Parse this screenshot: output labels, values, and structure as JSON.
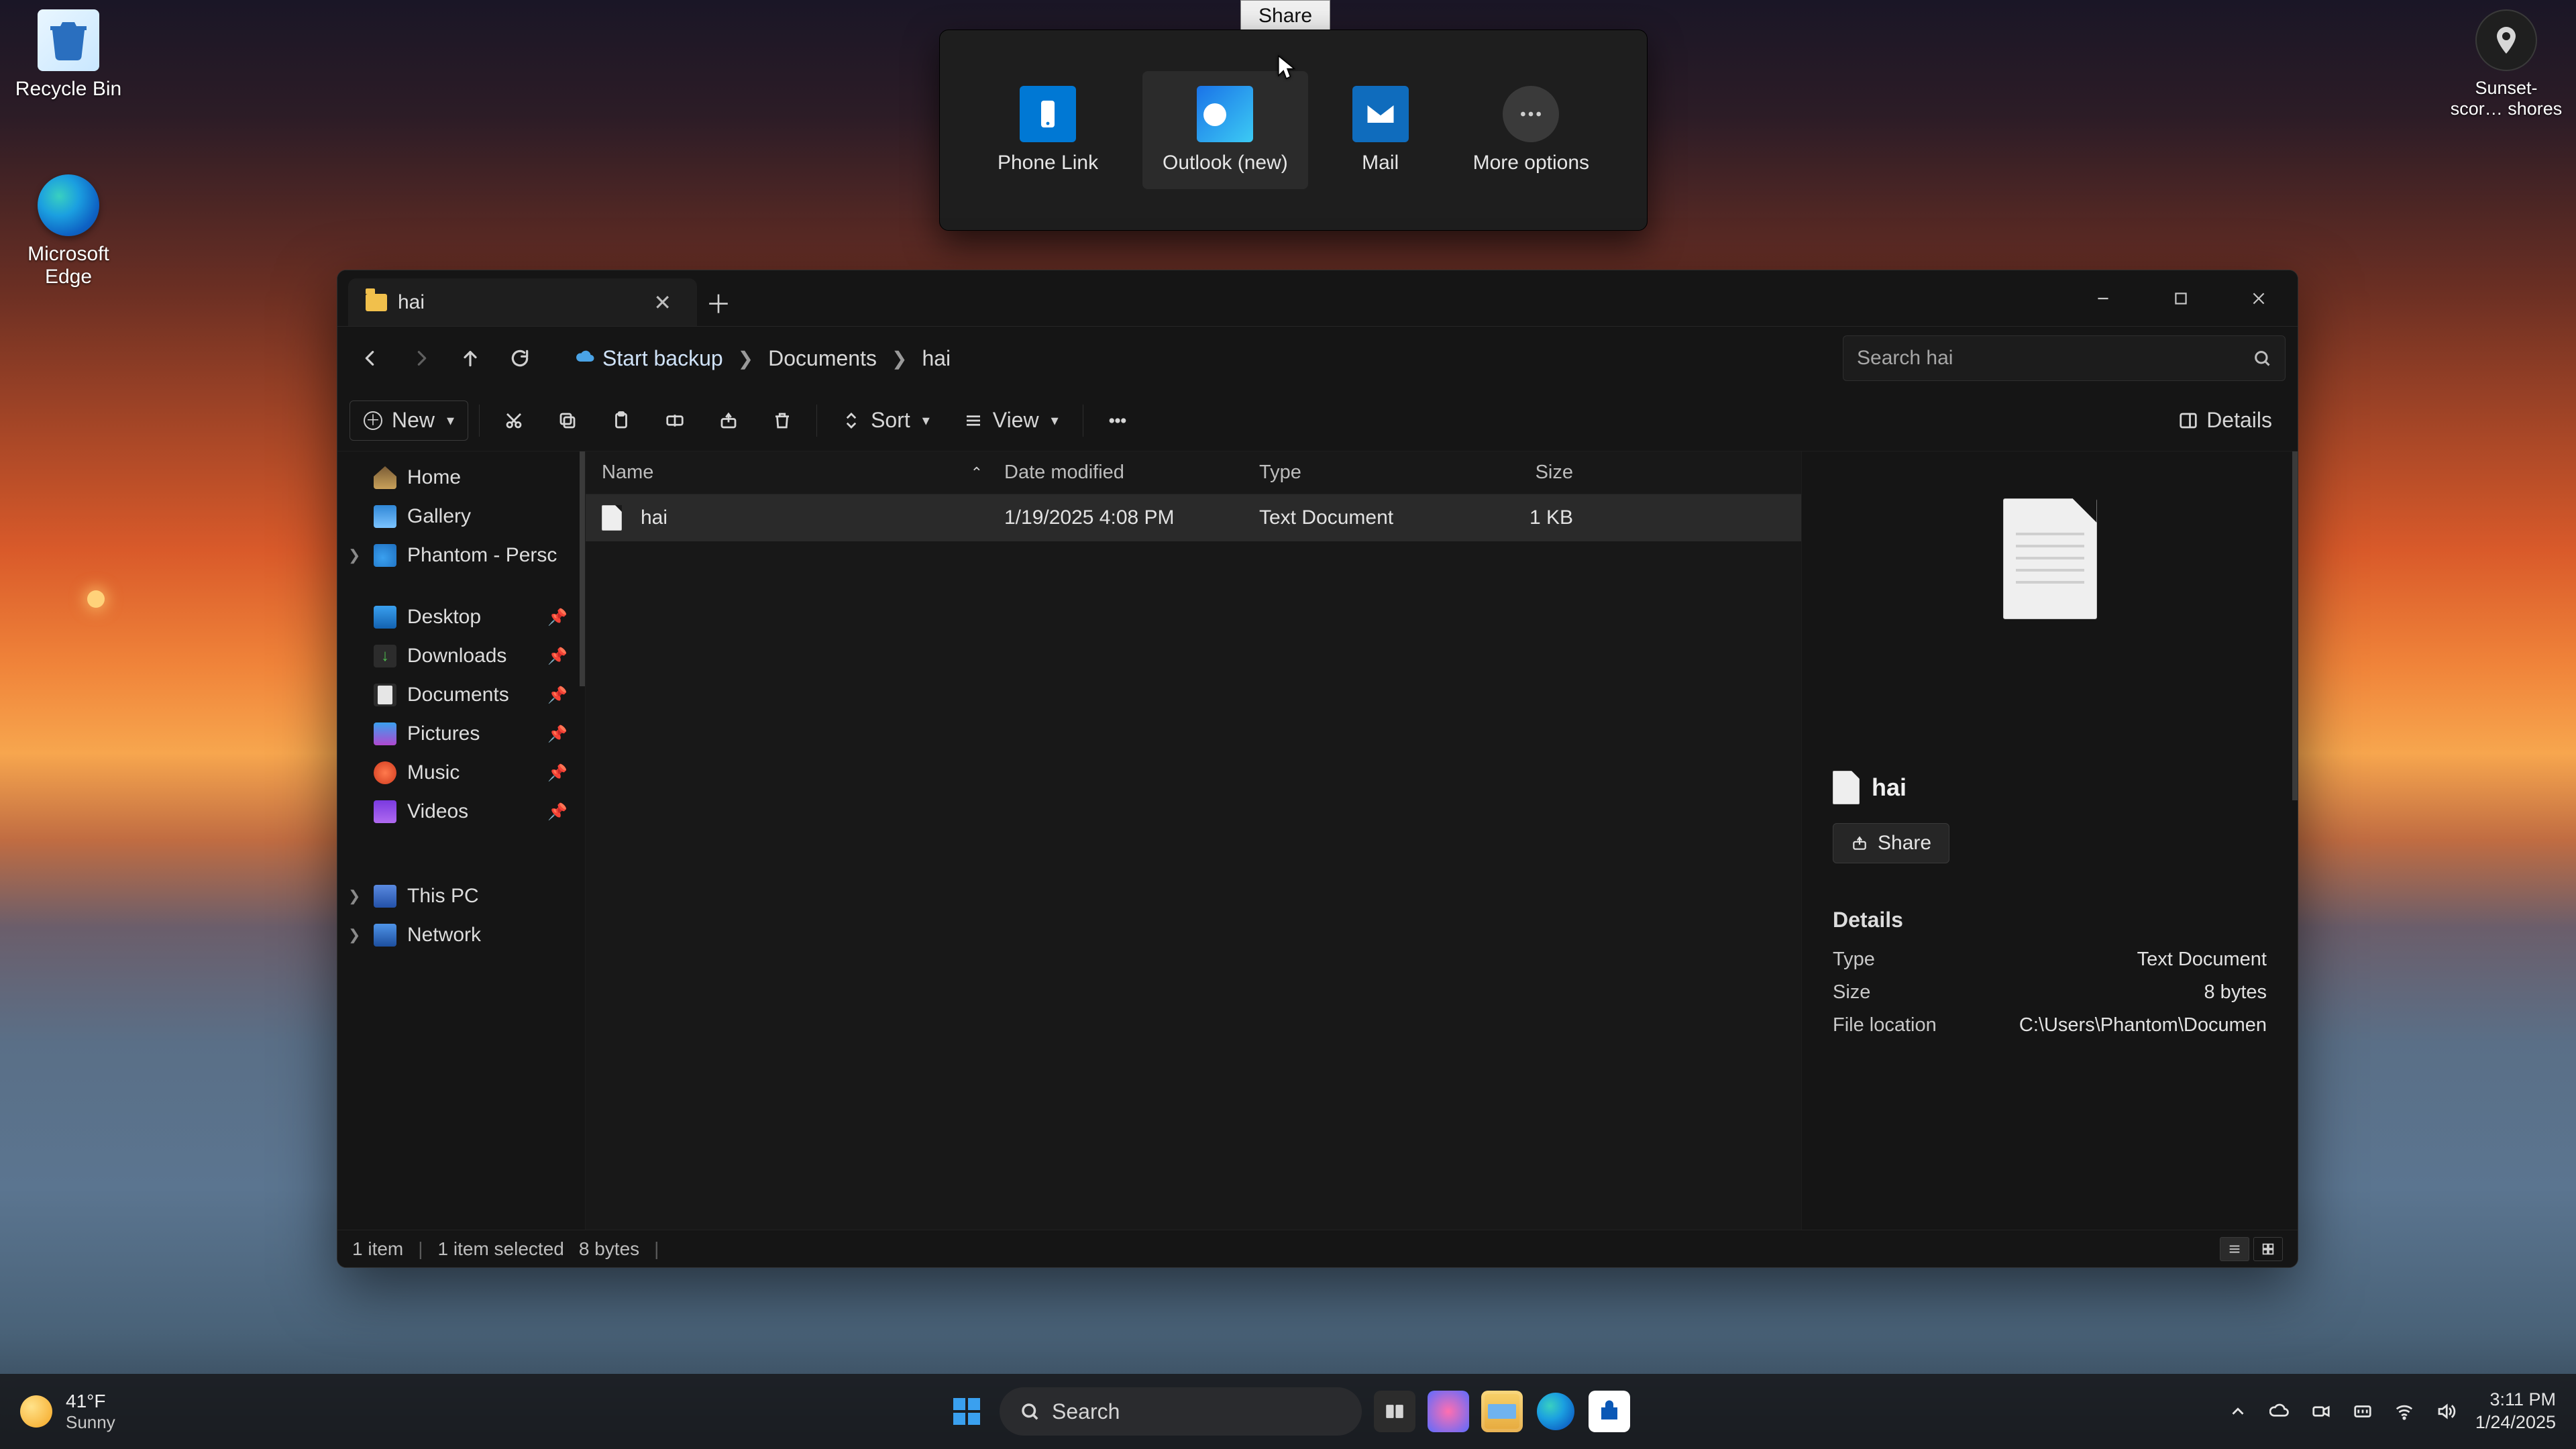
{
  "desktop": {
    "icons": {
      "recycle_bin": "Recycle Bin",
      "edge": "Microsoft Edge",
      "location_shortcut": "Sunset-scor… shores"
    }
  },
  "share": {
    "tooltip": "Share",
    "items": {
      "phone_link": "Phone Link",
      "outlook_new": "Outlook (new)",
      "mail": "Mail",
      "more": "More options"
    }
  },
  "window": {
    "tab_title": "hai",
    "nav": {
      "start_backup": "Start backup",
      "crumb1": "Documents",
      "crumb2": "hai",
      "search_placeholder": "Search hai"
    },
    "toolbar": {
      "new_label": "New",
      "sort_label": "Sort",
      "view_label": "View",
      "details_label": "Details"
    },
    "columns": {
      "name": "Name",
      "date": "Date modified",
      "type": "Type",
      "size": "Size"
    },
    "rows": [
      {
        "name": "hai",
        "date": "1/19/2025 4:08 PM",
        "type": "Text Document",
        "size": "1 KB"
      }
    ],
    "sidebar": {
      "home": "Home",
      "gallery": "Gallery",
      "onedrive": "Phantom - Persc",
      "desktop": "Desktop",
      "downloads": "Downloads",
      "documents": "Documents",
      "pictures": "Pictures",
      "music": "Music",
      "videos": "Videos",
      "thispc": "This PC",
      "network": "Network"
    },
    "details": {
      "filename": "hai",
      "share_label": "Share",
      "heading": "Details",
      "type_k": "Type",
      "type_v": "Text Document",
      "size_k": "Size",
      "size_v": "8 bytes",
      "loc_k": "File location",
      "loc_v": "C:\\Users\\Phantom\\Documen"
    },
    "status": {
      "count": "1 item",
      "selected": "1 item selected",
      "bytes": "8 bytes"
    }
  },
  "taskbar": {
    "weather_temp": "41°F",
    "weather_cond": "Sunny",
    "search_placeholder": "Search",
    "clock_time": "3:11 PM",
    "clock_date": "1/24/2025"
  }
}
